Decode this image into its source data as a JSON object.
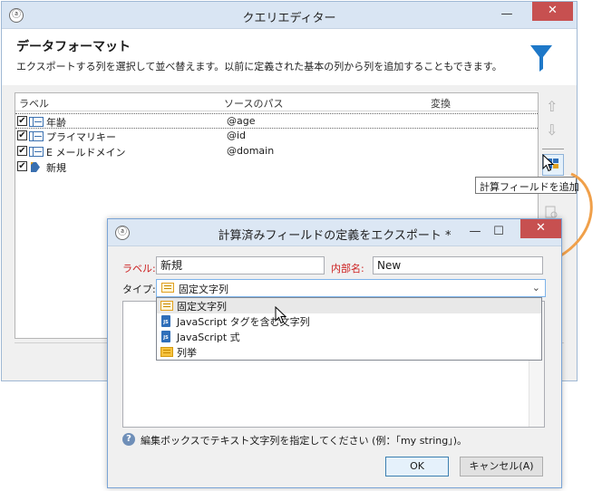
{
  "main_window": {
    "title": "クエリエディター",
    "minimize_glyph": "—",
    "close_glyph": "✕",
    "header_title": "データフォーマット",
    "header_desc": "エクスポートする列を選択して並べ替えます。以前に定義された基本の列から列を追加することもできます。",
    "columns": {
      "label": "ラベル",
      "source_path": "ソースのパス",
      "transform": "変換"
    },
    "rows": [
      {
        "checked": "✔",
        "label": "年齢",
        "path": "@age",
        "icon": "field-icon"
      },
      {
        "checked": "✔",
        "label": "プライマリキー",
        "path": "@id",
        "icon": "field-icon"
      },
      {
        "checked": "✔",
        "label": "E メールドメイン",
        "path": "@domain",
        "icon": "field-icon"
      },
      {
        "checked": "✔",
        "label": "新規",
        "path": "",
        "icon": "new-field-icon"
      }
    ],
    "move_up_glyph": "⇧",
    "move_down_glyph": "⇩",
    "tooltip": "計算フィールドを追加"
  },
  "dialog": {
    "title": "計算済みフィールドの定義をエクスポート *",
    "minimize_glyph": "—",
    "maximize_glyph": "☐",
    "close_glyph": "✕",
    "label_caption": "ラベル:",
    "label_value": "新規",
    "internal_name_caption": "内部名:",
    "internal_name_value": "New",
    "type_caption": "タイプ:",
    "type_selected": "固定文字列",
    "type_options": [
      {
        "label": "固定文字列",
        "icon": "list-icon"
      },
      {
        "label": "JavaScript タグを含む文字列",
        "icon": "javascript-icon"
      },
      {
        "label": "JavaScript 式",
        "icon": "javascript-icon"
      },
      {
        "label": "列挙",
        "icon": "enum-icon"
      }
    ],
    "help_text": "編集ボックスでテキスト文字列を指定してください (例：「my string」)。",
    "ok_label": "OK",
    "cancel_label": "キャンセル(A)"
  },
  "colors": {
    "title_bar": "#d9e5f3",
    "close_red": "#c75050",
    "required_label": "#cc1f1f",
    "funnel_blue": "#1e78c8",
    "connector_orange": "#f0a04a"
  }
}
